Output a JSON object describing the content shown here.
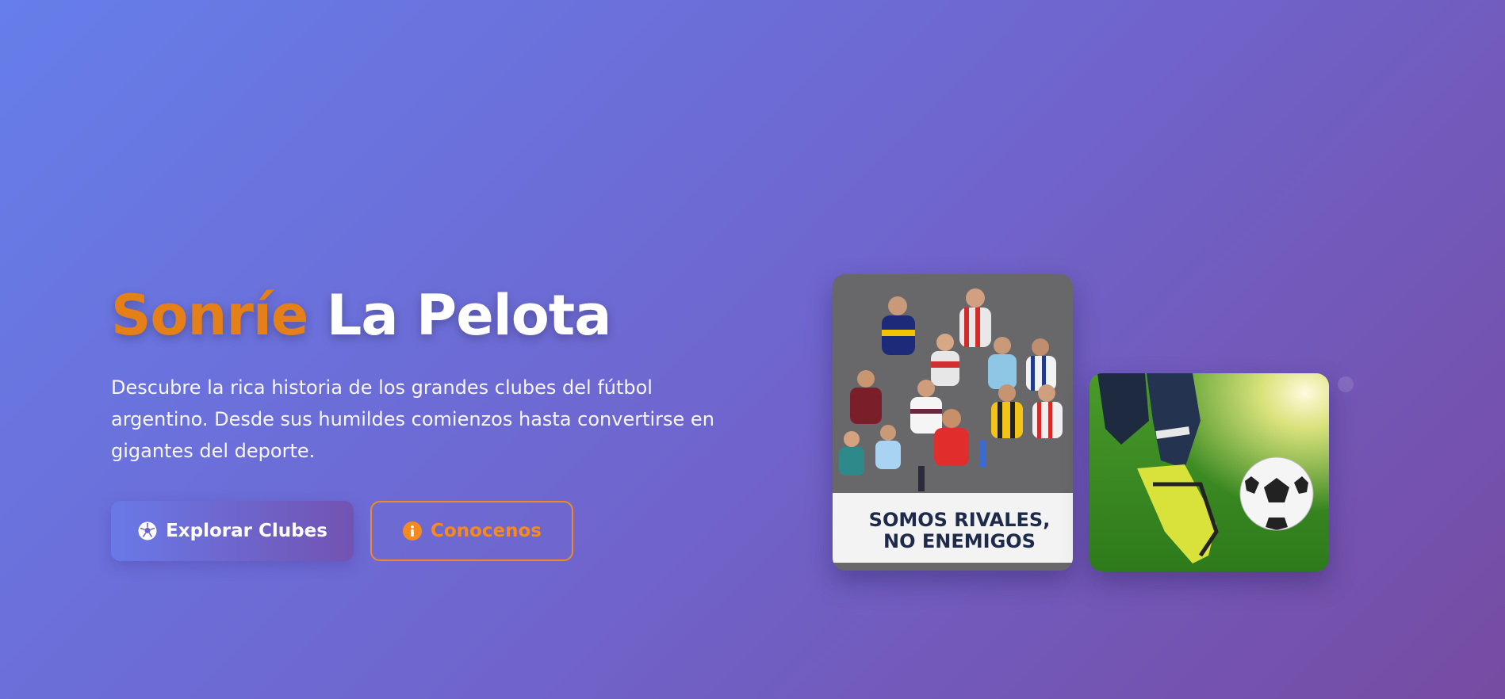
{
  "hero": {
    "title_accent": "Sonríe",
    "title_rest": "La Pelota",
    "description": "Descubre la rica historia de los grandes clubes del fútbol argentino. Desde sus humildes comienzos hasta convertirse en gigantes del deporte.",
    "primary_button": {
      "label": "Explorar Clubes",
      "icon": "soccer-ball-icon"
    },
    "secondary_button": {
      "label": "Conocenos",
      "icon": "info-icon"
    }
  },
  "images": {
    "fans_photo": {
      "banner_line_1": "SOMOS RIVALES,",
      "banner_line_2": "NO ENEMIGOS"
    },
    "ball_photo": {}
  },
  "colors": {
    "background_start": "#667eea",
    "background_end": "#764ba2",
    "accent": "#e57f17",
    "secondary_border": "#f08a24"
  }
}
